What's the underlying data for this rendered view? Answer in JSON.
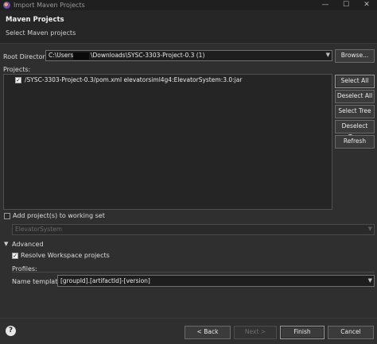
{
  "window": {
    "title": "Import Maven Projects",
    "min_glyph": "—",
    "max_glyph": "☐",
    "close_glyph": "✕",
    "icon": "eclipse-icon"
  },
  "header": {
    "title": "Maven Projects",
    "subtitle": "Select Maven projects"
  },
  "root": {
    "label": "Root Directory:",
    "value_prefix": "C:\\Users\\",
    "value_suffix": "\\Downloads\\SYSC-3303-Project-0.3 (1)",
    "browse_label": "Browse..."
  },
  "projects": {
    "label": "Projects:",
    "items": [
      {
        "label": "/SYSC-3303-Project-0.3/pom.xml  elevatorsiml4g4:ElevatorSystem:3.0:jar",
        "checked": true
      }
    ]
  },
  "buttons": {
    "select_all": "Select All",
    "deselect_all": "Deselect All",
    "select_tree": "Select Tree",
    "deselect_tree": "Deselect Tree",
    "refresh": "Refresh"
  },
  "working_set": {
    "label": "Add project(s) to working set",
    "value": "ElevatorSystem",
    "checked": false
  },
  "advanced": {
    "label": "Advanced",
    "resolve_label": "Resolve Workspace projects",
    "resolve_checked": true,
    "profiles_label": "Profiles:",
    "profiles_value": "",
    "name_template_label": "Name template:",
    "name_template_value": "[groupId].[artifactId]-[version]"
  },
  "footer": {
    "help": "?",
    "back": "< Back",
    "next": "Next >",
    "finish": "Finish",
    "cancel": "Cancel"
  }
}
